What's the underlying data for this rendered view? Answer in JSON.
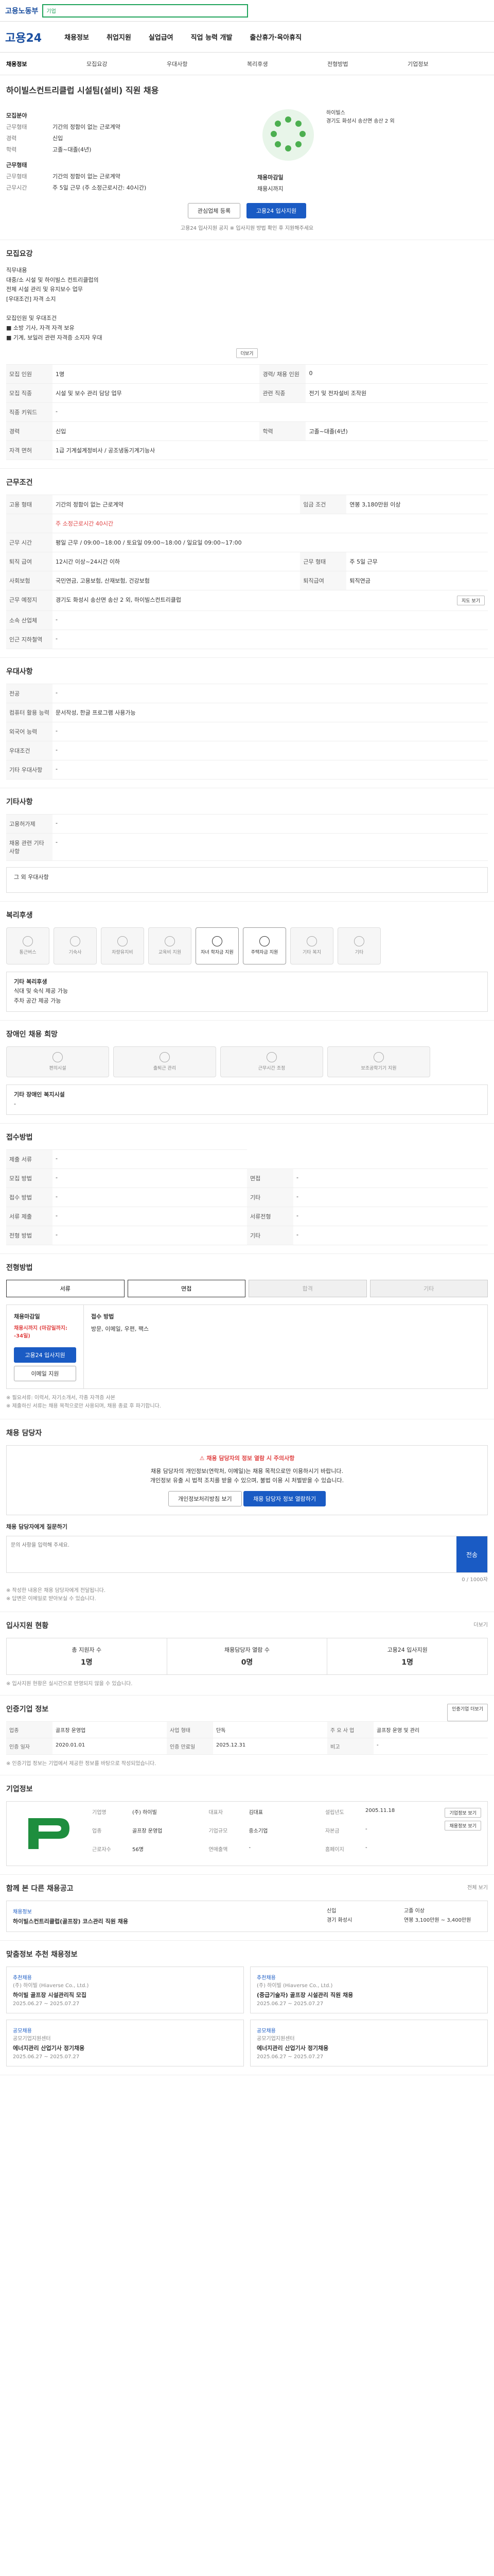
{
  "topbar": {
    "logo": "고용노동부",
    "search_placeholder": "",
    "search_tag": "기업"
  },
  "nav": {
    "brand": "고용24",
    "items": [
      "채용정보",
      "취업지원",
      "실업급여",
      "직업 능력 개발",
      "출산휴가·육아휴직"
    ]
  },
  "tabs": [
    "채용정보",
    "모집요강",
    "우대사항",
    "복리후생",
    "전형방법",
    "기업정보"
  ],
  "job": {
    "company": "하이빌스컨트리클럽 시설팀(설비) 직원 채용",
    "type_label": "모집분야",
    "kv": [
      {
        "k": "근무형태",
        "v": "기간의 정함이 없는 근로계약"
      },
      {
        "k": "경력",
        "v": "신입"
      },
      {
        "k": "학력",
        "v": "고졸~대졸(4년)"
      }
    ],
    "work_label": "근무형태",
    "work_kv": [
      {
        "k": "근무형태",
        "v": "기간의 정함이 없는 근로계약"
      },
      {
        "k": "근무시간",
        "v": "주 5일 근무 (주 소정근로시간: 40시간)"
      }
    ],
    "benefit_label": "채용마감일",
    "benefit_text": "채용시까지",
    "logo_name": "하이빌스",
    "logo_address": "경기도 화성시 송산면 송산 2 외",
    "btn_scrap": "관심업체 등록",
    "btn_apply": "고용24 입사지원",
    "note": "고용24 입사지원 공지 ※ 입사지원 방법 확인 후 지원해주세요"
  },
  "recruit": {
    "title": "모집요강",
    "task_label": "직무내용",
    "task_lines": [
      "직무내용",
      "대중/소 시설 및 하이빌스 컨트리클럽의",
      "전체 시설 관리 및 유지보수 업무",
      "[우대조건] 자격 소지",
      "",
      "모집인원 및 우대조건",
      "■ 소방 기사, 자격 자격 보유",
      "■ 기계, 보일러 관련 자격증 소지자 우대"
    ],
    "more": "더보기",
    "rows": [
      {
        "k": "모집 인원",
        "v": "1명",
        "k2": "경력/ 채용 인원",
        "v2": "0"
      },
      {
        "k": "모집 직종",
        "v": "시설 및 보수 관리 담당 업무",
        "k2": "관련 직종",
        "v2": "전기 및 전자설비 조작원"
      },
      {
        "k": "직종 키워드",
        "v": "-"
      },
      {
        "k": "경력",
        "v": "신입",
        "k2": "학력",
        "v2": "고졸~대졸(4년)"
      },
      {
        "k": "자격 면허",
        "v": "1급 기계설계정비사 / 공조냉동기계기능사"
      }
    ]
  },
  "conditions": {
    "title": "근무조건",
    "rows": [
      {
        "k": "고용 형태",
        "v": "기간의 정함이 없는 근로계약",
        "k2": "임금 조건",
        "v2": "연봉 3,180만원 이상"
      },
      {
        "k": "",
        "v": "주 소정근로시간 40시간"
      },
      {
        "k": "근무 시간",
        "v": "평일 근무 / 09:00~18:00 / 토요일 09:00~18:00 / 일요일 09:00~17:00"
      },
      {
        "k": "퇴직 급여",
        "v": "12시간 이상~24시간 이하",
        "k2": "근무 형태",
        "v2": "주 5일 근무"
      },
      {
        "k": "사회보험",
        "v": "국민연금, 고용보험, 산재보험, 건강보험",
        "k2": "퇴직급여",
        "v2": "퇴직연금"
      },
      {
        "k": "근무 예정지",
        "v": "경기도 화성시 송산면 송산 2 외, 하이빌스컨트리클럽"
      },
      {
        "k": "소속 산업체",
        "v": "-"
      },
      {
        "k": "인근 지하철역",
        "v": "-"
      }
    ],
    "map_btn": "지도 보기"
  },
  "prefer": {
    "title": "우대사항",
    "rows": [
      {
        "k": "전공",
        "v": "-"
      },
      {
        "k": "컴퓨터 활용 능력",
        "v": "문서작성, 한글 프로그램 사용가능"
      },
      {
        "k": "외국어 능력",
        "v": "-"
      },
      {
        "k": "우대조건",
        "v": "-"
      },
      {
        "k": "기타 우대사항",
        "v": "-"
      }
    ]
  },
  "other": {
    "title": "기타사항",
    "rows": [
      {
        "k": "고용허가제",
        "v": "-"
      },
      {
        "k": "채용 관련 기타 사항",
        "v": "-"
      }
    ],
    "extra": "그 외 우대사항"
  },
  "welfare": {
    "title": "복리후생",
    "icons": [
      "통근버스",
      "기숙사",
      "차량유지비",
      "교육비 지원",
      "자녀 학자금 지원",
      "주택자금 지원",
      "기타 복지",
      "기타"
    ],
    "on": [
      4,
      5
    ],
    "list_title": "기타 복리후생",
    "list": [
      "식대 및 숙식 제공 가능",
      "주차 공간 제공 가능"
    ]
  },
  "disability": {
    "title": "장애인 채용 희망",
    "icons": [
      "편의시설",
      "출퇴근 관리",
      "근무시간 조정",
      "보조공학기기 지원"
    ],
    "list_title": "기타 장애인 복지시설",
    "list": [
      "-"
    ]
  },
  "apply": {
    "title": "접수방법",
    "rows": [
      {
        "k": "제출 서류",
        "v": "-"
      },
      {
        "k": "모집 방법",
        "v": "-"
      },
      {
        "k": "접수 방법",
        "v": "-"
      },
      {
        "k": "서류 제출",
        "v": "-"
      },
      {
        "k": "전형 방법",
        "v": "-"
      }
    ],
    "k2": [
      "면접",
      "기타",
      "서류전형",
      "기타"
    ]
  },
  "process": {
    "title": "전형방법",
    "steps": [
      "서류",
      "면접",
      "합격",
      "기타"
    ],
    "on": [
      0,
      1
    ],
    "deadline_label": "채용마감일",
    "deadline": "채용시까지 (마감일까지: -34일)",
    "doc_label": "접수 방법",
    "doc_text": "방문, 이메일, 우편, 팩스",
    "btn_apply": "고용24 입사지원",
    "btn_email": "이메일 지원",
    "notes": [
      "※ 필요서류: 이력서, 자기소개서, 각종 자격증 사본",
      "※ 제출하신 서류는 채용 목적으로만 사용되며, 채용 종료 후 파기합니다."
    ]
  },
  "contact": {
    "title": "채용 담당자",
    "warn_title": "채용 담당자의 정보 열람 시 주의사항",
    "warn_lines": [
      "채용 담당자의 개인정보(연락처, 이메일)는 채용 목적으로만 이용하시기 바랍니다.",
      "개인정보 유출 시 법적 조치를 받을 수 있으며, 불법 이용 시 처벌받을 수 있습니다."
    ],
    "btn1": "개인정보처리방침 보기",
    "btn2": "채용 담당자 정보 열람하기",
    "qa_label": "채용 담당자에게 질문하기",
    "qa_placeholder": "문의 사항을 입력해 주세요.",
    "qa_btn": "전송",
    "qa_count": "0 / 1000자",
    "notes": [
      "※ 작성한 내용은 채용 담당자에게 전달됩니다.",
      "※ 답변은 이메일로 받아보실 수 있습니다."
    ]
  },
  "stats": {
    "title": "입사지원 현황",
    "more": "더보기",
    "items": [
      {
        "label": "총 지원자 수",
        "value": "1명"
      },
      {
        "label": "채용담당자 열람 수",
        "value": "0명"
      },
      {
        "label": "고용24 입사지원",
        "value": "1명"
      }
    ],
    "note": "※ 입사지원 현황은 실시간으로 반영되지 않을 수 있습니다."
  },
  "info": {
    "title": "인증기업 정보",
    "more_btn": "인증기업 더보기",
    "rows": [
      [
        "업종",
        "골프장 운영업",
        "사업 형태",
        "단독",
        "주 요 사 업",
        "골프장 운영 및 관리"
      ],
      [
        "인증 일자",
        "2020.01.01",
        "인증 만료일",
        "2025.12.31",
        "비고",
        "-"
      ]
    ],
    "note": "※ 인증기업 정보는 기업에서 제공한 정보를 바탕으로 작성되었습니다."
  },
  "company": {
    "title": "기업정보",
    "name_label": "기업명",
    "name": "(주) 하이빌",
    "ceo_label": "대표자",
    "ceo": "김대표",
    "industry_label": "업종",
    "industry": "골프장 운영업",
    "size_label": "기업규모",
    "size": "중소기업",
    "emp_label": "근로자수",
    "emp": "56명",
    "found_label": "설립년도",
    "found": "2005.11.18",
    "capital_label": "자본금",
    "capital": "-",
    "sales_label": "연매출액",
    "sales": "-",
    "site_label": "홈페이지",
    "site": "-",
    "btn_more": "기업정보 보기",
    "btn_list": "채용정보 보기"
  },
  "related": {
    "title": "함께 본 다른 채용공고",
    "more": "전체 보기",
    "card": {
      "tag": "채용정보",
      "title": "하이빌스컨트리클럽(골프장) 코스관리 직원 채용",
      "kv": [
        "신입",
        "고졸 이상",
        "경기 화성시",
        "연봉 3,100만원 ~ 3,400만원"
      ]
    }
  },
  "rec": {
    "title": "맞춤정보 추천 채용정보",
    "cards": [
      {
        "tag": "추천채용",
        "company": "(주) 하이빌 (Hiaverse Co., Ltd.)",
        "title": "하이빌 골프장 시설관리직 모집",
        "date": "2025.06.27 ~ 2025.07.27"
      },
      {
        "tag": "추천채용",
        "company": "(주) 하이빌 (Hiaverse Co., Ltd.)",
        "title": "(중급기술자) 골프장 시설관리 직원 채용",
        "date": "2025.06.27 ~ 2025.07.27"
      }
    ],
    "cards2": [
      {
        "tag": "공모채용",
        "company": "공모기업지원센터",
        "title": "에너지관리 산업기사 정기채용",
        "date": "2025.06.27 ~ 2025.07.27"
      },
      {
        "tag": "공모채용",
        "company": "공모기업지원센터",
        "title": "에너지관리 산업기사 정기채용",
        "date": "2025.06.27 ~ 2025.07.27"
      }
    ]
  }
}
